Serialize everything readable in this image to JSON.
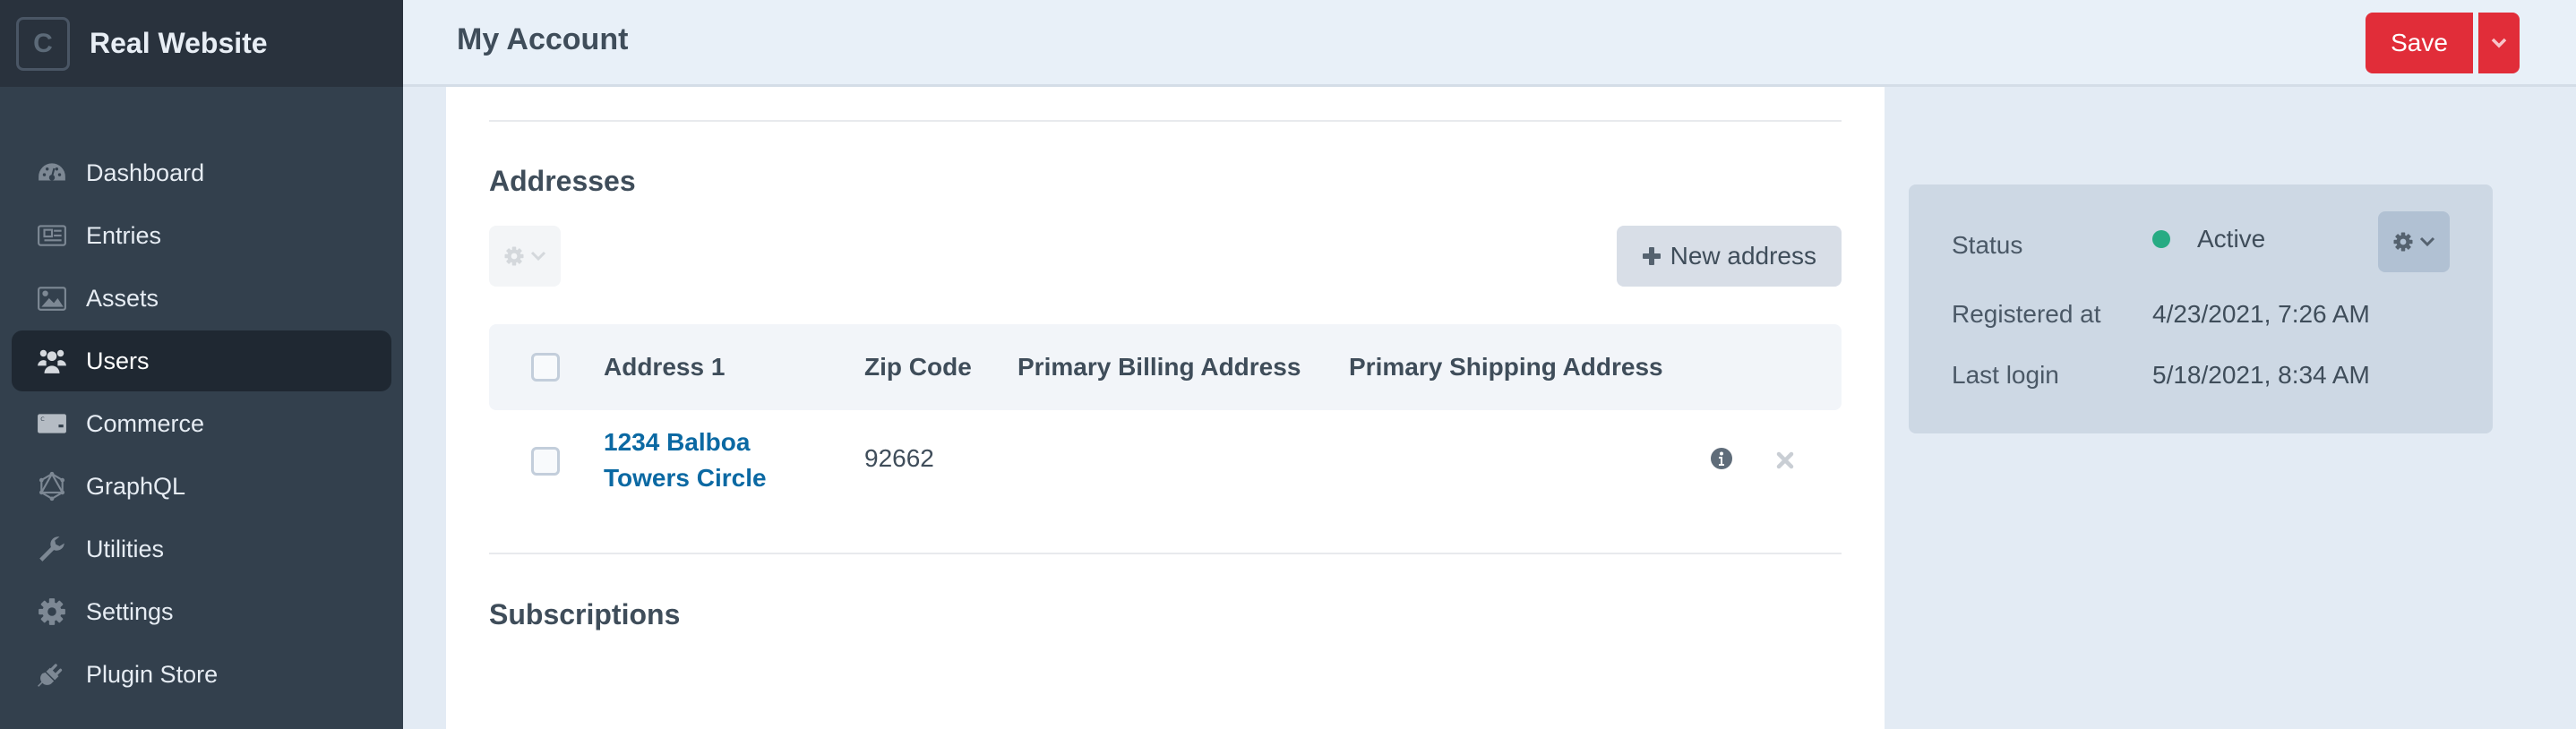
{
  "sidebar": {
    "logo_letter": "C",
    "site_name": "Real Website",
    "items": [
      {
        "label": "Dashboard",
        "icon": "gauge-icon",
        "active": false
      },
      {
        "label": "Entries",
        "icon": "newspaper-icon",
        "active": false
      },
      {
        "label": "Assets",
        "icon": "image-icon",
        "active": false
      },
      {
        "label": "Users",
        "icon": "users-icon",
        "active": true
      },
      {
        "label": "Commerce",
        "icon": "credit-card-icon",
        "active": false
      },
      {
        "label": "GraphQL",
        "icon": "graphql-icon",
        "active": false
      },
      {
        "label": "Utilities",
        "icon": "wrench-icon",
        "active": false
      },
      {
        "label": "Settings",
        "icon": "gear-icon",
        "active": false
      },
      {
        "label": "Plugin Store",
        "icon": "plug-icon",
        "active": false
      }
    ]
  },
  "header": {
    "title": "My Account",
    "save_label": "Save"
  },
  "addresses": {
    "title": "Addresses",
    "new_address_label": "New address",
    "columns": [
      "Address 1",
      "Zip Code",
      "Primary Billing Address",
      "Primary Shipping Address"
    ],
    "rows": [
      {
        "address1_line1": "1234 Balboa",
        "address1_line2": "Towers Circle",
        "zip": "92662",
        "primary_billing": "",
        "primary_shipping": ""
      }
    ]
  },
  "subscriptions": {
    "title": "Subscriptions"
  },
  "meta": {
    "status_label": "Status",
    "status_value": "Active",
    "status_color": "#27ab83",
    "registered_label": "Registered at",
    "registered_value": "4/23/2021, 7:26 AM",
    "last_login_label": "Last login",
    "last_login_value": "5/18/2021, 8:34 AM"
  },
  "colors": {
    "accent_red": "#e12d39",
    "link_blue": "#0b69a3",
    "sidebar_bg": "#33404d"
  }
}
